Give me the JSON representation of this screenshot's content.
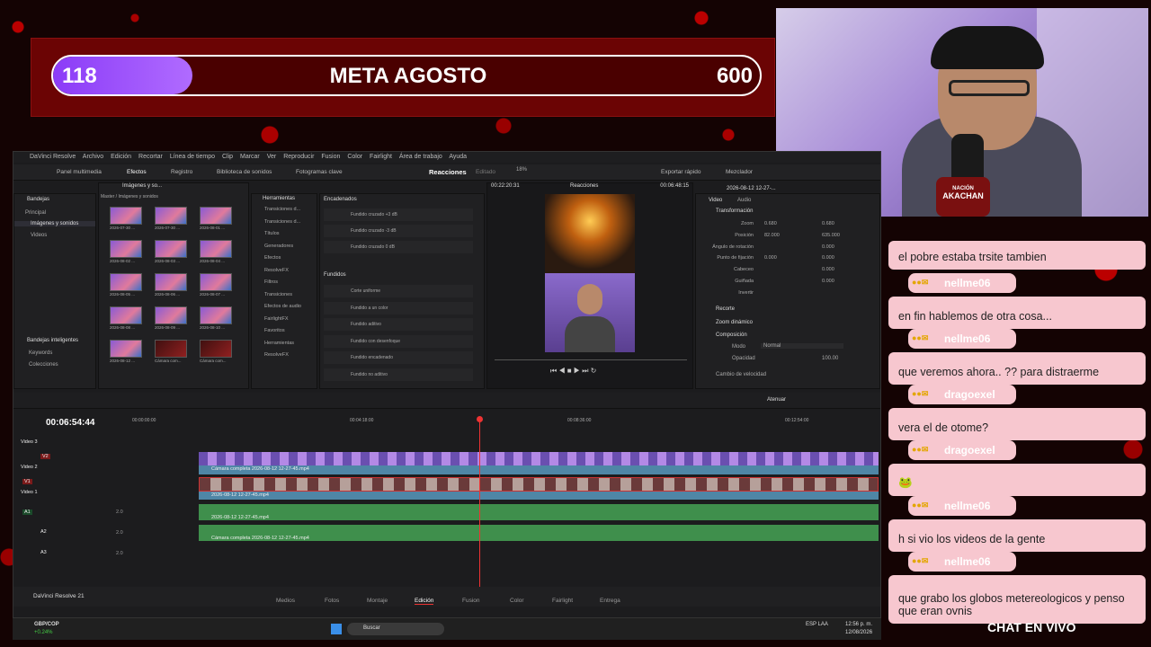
{
  "goal": {
    "current": "118",
    "title": "META AGOSTO",
    "target": "600",
    "progress": 0.197
  },
  "resolve": {
    "menu": [
      "DaVinci Resolve",
      "Archivo",
      "Edición",
      "Recortar",
      "Línea de tiempo",
      "Clip",
      "Marcar",
      "Ver",
      "Reproducir",
      "Fusion",
      "Color",
      "Fairlight",
      "Área de trabajo",
      "Ayuda"
    ],
    "toolbar": {
      "media_pool": "Panel multimedia",
      "effects": "Efectos",
      "log": "Registro",
      "sound_lib": "Biblioteca de sonidos",
      "keyframes": "Fotogramas clave",
      "project": "Reacciones",
      "status": "Editado",
      "export": "Exportar rápido",
      "mixer": "Mezclador"
    },
    "bins": {
      "header": "Bandejas",
      "root": "Principal",
      "items": [
        "Imágenes y sonidos",
        "Videos"
      ],
      "smart": "Bandejas inteligentes",
      "smart_items": [
        "Keywords",
        "Colecciones"
      ]
    },
    "pool": {
      "title": "Imágenes y so...",
      "path": "Master / Imágenes y sonidos",
      "thumbs": [
        "2026-07-30 ...",
        "2026-07-30 ...",
        "2026-08-01 ...",
        "2026-08-02 ...",
        "2026-08-03 ...",
        "2026-08-04 ...",
        "2026-08-05 ...",
        "2026-08-06 ...",
        "2026-08-07 ...",
        "2026-08-08 ...",
        "2026-08-09 ...",
        "2026-08-10 ...",
        "2026-08-12 ...",
        "Cámara com...",
        "Cámara com..."
      ]
    },
    "tools": {
      "header": "Herramientas",
      "items": [
        "Transiciones d...",
        "Transiciones d...",
        "Títulos",
        "Generadores",
        "Efectos",
        "ResolveFX",
        "Filtros",
        "Transiciones",
        "Efectos de audio",
        "FairlightFX",
        "Favoritos",
        "Herramientas",
        "ResolveFX"
      ]
    },
    "fx": {
      "section1": "Encadenados",
      "items1": [
        "Fundido cruzado +3 dB",
        "Fundido cruzado -3 dB",
        "Fundido cruzado 0 dB"
      ],
      "section2": "Fundidos",
      "items2": [
        "Corte uniforme",
        "Fundido a un color",
        "Fundido aditivo",
        "Fundido con desenfoque",
        "Fundido encadenado",
        "Fundido no aditivo"
      ]
    },
    "viewer": {
      "timecode_left": "00:22:20:31",
      "title": "Reacciones",
      "timecode_right": "00:06:48:15",
      "zoom": "18%"
    },
    "inspector": {
      "title": "2026-08-12 12-27-...",
      "tabs": [
        "Video",
        "Audio"
      ],
      "section": "Transformación",
      "rows": [
        {
          "label": "Zoom",
          "x": "0.680",
          "y": "0.680"
        },
        {
          "label": "Posición",
          "x": "82.000",
          "y": "635.000"
        },
        {
          "label": "Ángulo de rotación",
          "x": "",
          "y": "0.000"
        },
        {
          "label": "Punto de fijación",
          "x": "0.000",
          "y": "0.000"
        },
        {
          "label": "Cabeceo",
          "x": "",
          "y": "0.000"
        },
        {
          "label": "Guiñada",
          "x": "",
          "y": "0.000"
        },
        {
          "label": "Invertir",
          "x": "",
          "y": ""
        }
      ],
      "crop": "Recorte",
      "dyn_zoom": "Zoom dinámico",
      "composite": "Composición",
      "mode_label": "Modo",
      "mode_value": "Normal",
      "opacity_label": "Opacidad",
      "opacity_value": "100.00",
      "speed": "Cambio de velocidad",
      "attenuate": "Atenuar"
    },
    "timeline": {
      "timecode": "00:06:54:44",
      "ruler": [
        "00:00:00:00",
        "00:04:18:00",
        "00:08:36:00",
        "00:12:54:00"
      ],
      "tracks": [
        "Video 3",
        "Video 2",
        "Video 1"
      ],
      "clip_v2": "Cámara completa 2026-08-12 12-27-45.mp4",
      "clip_v1": "2026-08-12 12-27-45.mp4",
      "clip_a1": "2026-08-12 12-27-45.mp4",
      "clip_a2": "Cámara completa 2026-08-12 12-27-45.mp4",
      "labels": [
        "V2",
        "V1",
        "A1",
        "A2",
        "A3"
      ],
      "vol": [
        "2.0",
        "2.0",
        "2.0"
      ]
    },
    "pages": [
      "Medios",
      "Fotos",
      "Montaje",
      "Edición",
      "Fusion",
      "Color",
      "Fairlight",
      "Entrega"
    ],
    "active_page": "Edición",
    "app_name": "DaVinci Resolve 21"
  },
  "taskbar": {
    "ticker": "GBP/COP",
    "change": "+0.24%",
    "search": "Buscar",
    "lang": "ESP\nLAA",
    "time": "12:56 p. m.",
    "date": "12/08/2026"
  },
  "chat": {
    "title": "CHAT EN VIVO",
    "messages": [
      {
        "name": "",
        "text": "el pobre estaba trsite tambien"
      },
      {
        "name": "nellme06",
        "text": "en fin hablemos de otra cosa..."
      },
      {
        "name": "nellme06",
        "text": "que veremos ahora.. ?? para distraerme"
      },
      {
        "name": "dragoexel",
        "text": "vera el de otome?"
      },
      {
        "name": "dragoexel",
        "text": "🐸"
      },
      {
        "name": "nellme06",
        "text": "h si vio los videos de la gente"
      },
      {
        "name": "nellme06",
        "text": "que grabo los globos metereologicos y penso que eran ovnis"
      }
    ]
  },
  "cam": {
    "badge_top": "NACIÓN",
    "badge_name": "AKACHAN"
  }
}
